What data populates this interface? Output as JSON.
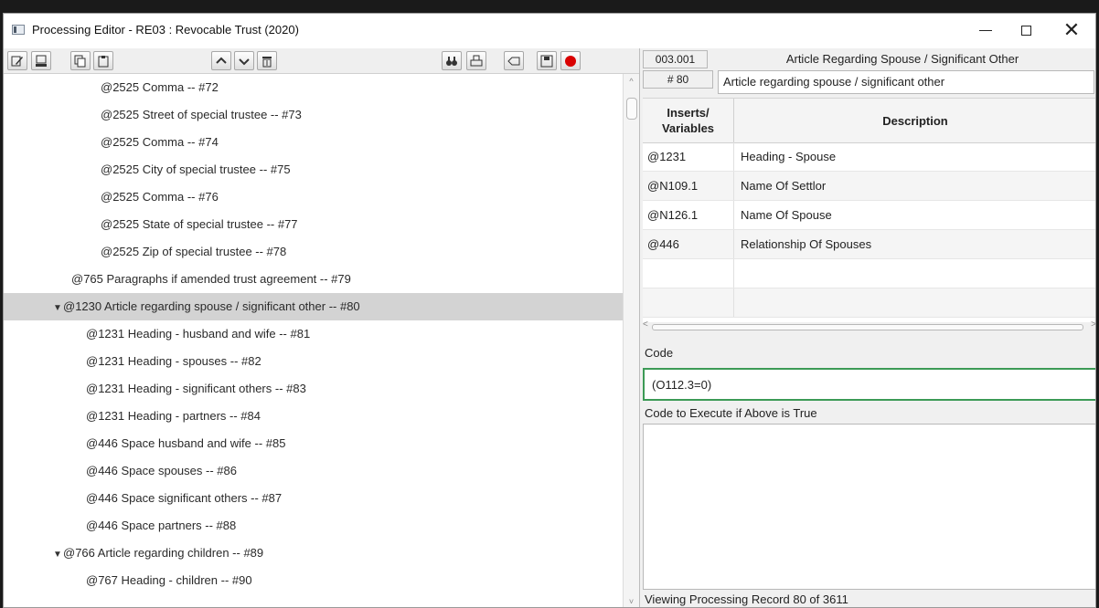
{
  "window": {
    "title": "Processing Editor - RE03 : Revocable Trust (2020)",
    "controls": {
      "minimize": "–",
      "maximize": "□",
      "close": "✕"
    }
  },
  "toolbar": {
    "buttons": [
      {
        "name": "edit-icon"
      },
      {
        "name": "print-preview-icon"
      },
      {
        "name": "copy-icon"
      },
      {
        "name": "paste-icon"
      },
      {
        "name": "move-up-icon"
      },
      {
        "name": "move-down-icon"
      },
      {
        "name": "delete-icon"
      },
      {
        "name": "find-icon"
      },
      {
        "name": "print-icon"
      },
      {
        "name": "tag-icon"
      },
      {
        "name": "save-icon"
      },
      {
        "name": "record-icon"
      }
    ]
  },
  "tree": {
    "rows": [
      {
        "text": "@2525 Comma  -- #72",
        "arrow": ""
      },
      {
        "text": "@2525 Street of special trustee  -- #73",
        "arrow": ""
      },
      {
        "text": "@2525 Comma  -- #74",
        "arrow": ""
      },
      {
        "text": "@2525 City of special trustee  -- #75",
        "arrow": ""
      },
      {
        "text": "@2525 Comma  -- #76",
        "arrow": ""
      },
      {
        "text": "@2525 State of special trustee  -- #77",
        "arrow": ""
      },
      {
        "text": "@2525 Zip of special trustee  -- #78",
        "arrow": ""
      },
      {
        "text": "@765 Paragraphs if amended trust agreement  -- #79",
        "arrow": ""
      },
      {
        "text": "@1230 Article regarding spouse / significant other  -- #80",
        "arrow": "▼",
        "selected": true
      },
      {
        "text": "@1231 Heading - husband and wife  -- #81",
        "arrow": ""
      },
      {
        "text": "@1231 Heading - spouses  -- #82",
        "arrow": ""
      },
      {
        "text": "@1231 Heading - significant others  -- #83",
        "arrow": ""
      },
      {
        "text": "@1231 Heading - partners  -- #84",
        "arrow": ""
      },
      {
        "text": "@446 Space husband and wife  -- #85",
        "arrow": ""
      },
      {
        "text": "@446 Space spouses  -- #86",
        "arrow": ""
      },
      {
        "text": "@446 Space significant others  -- #87",
        "arrow": ""
      },
      {
        "text": "@446 Space partners  -- #88",
        "arrow": ""
      },
      {
        "text": "@766 Article regarding children  -- #89",
        "arrow": "▼"
      },
      {
        "text": "@767 Heading - children  -- #90",
        "arrow": ""
      }
    ]
  },
  "record": {
    "code": "003.001",
    "title": "Article Regarding Spouse / Significant Other",
    "number": "# 80",
    "description": "Article regarding spouse / significant other"
  },
  "grid": {
    "headers": [
      "Inserts/ Variables",
      "Description"
    ],
    "rows": [
      {
        "var": "@1231",
        "desc": "Heading - Spouse"
      },
      {
        "var": "@N109.1",
        "desc": "Name Of Settlor"
      },
      {
        "var": "@N126.1",
        "desc": "Name Of Spouse"
      },
      {
        "var": "@446",
        "desc": "Relationship Of Spouses"
      },
      {
        "var": "",
        "desc": ""
      },
      {
        "var": "",
        "desc": ""
      }
    ]
  },
  "code": {
    "label": "Code",
    "value": "(O112.3=0)",
    "exec_label": "Code to Execute if Above is True",
    "exec_value": ""
  },
  "status": "Viewing Processing Record 80 of 3611"
}
